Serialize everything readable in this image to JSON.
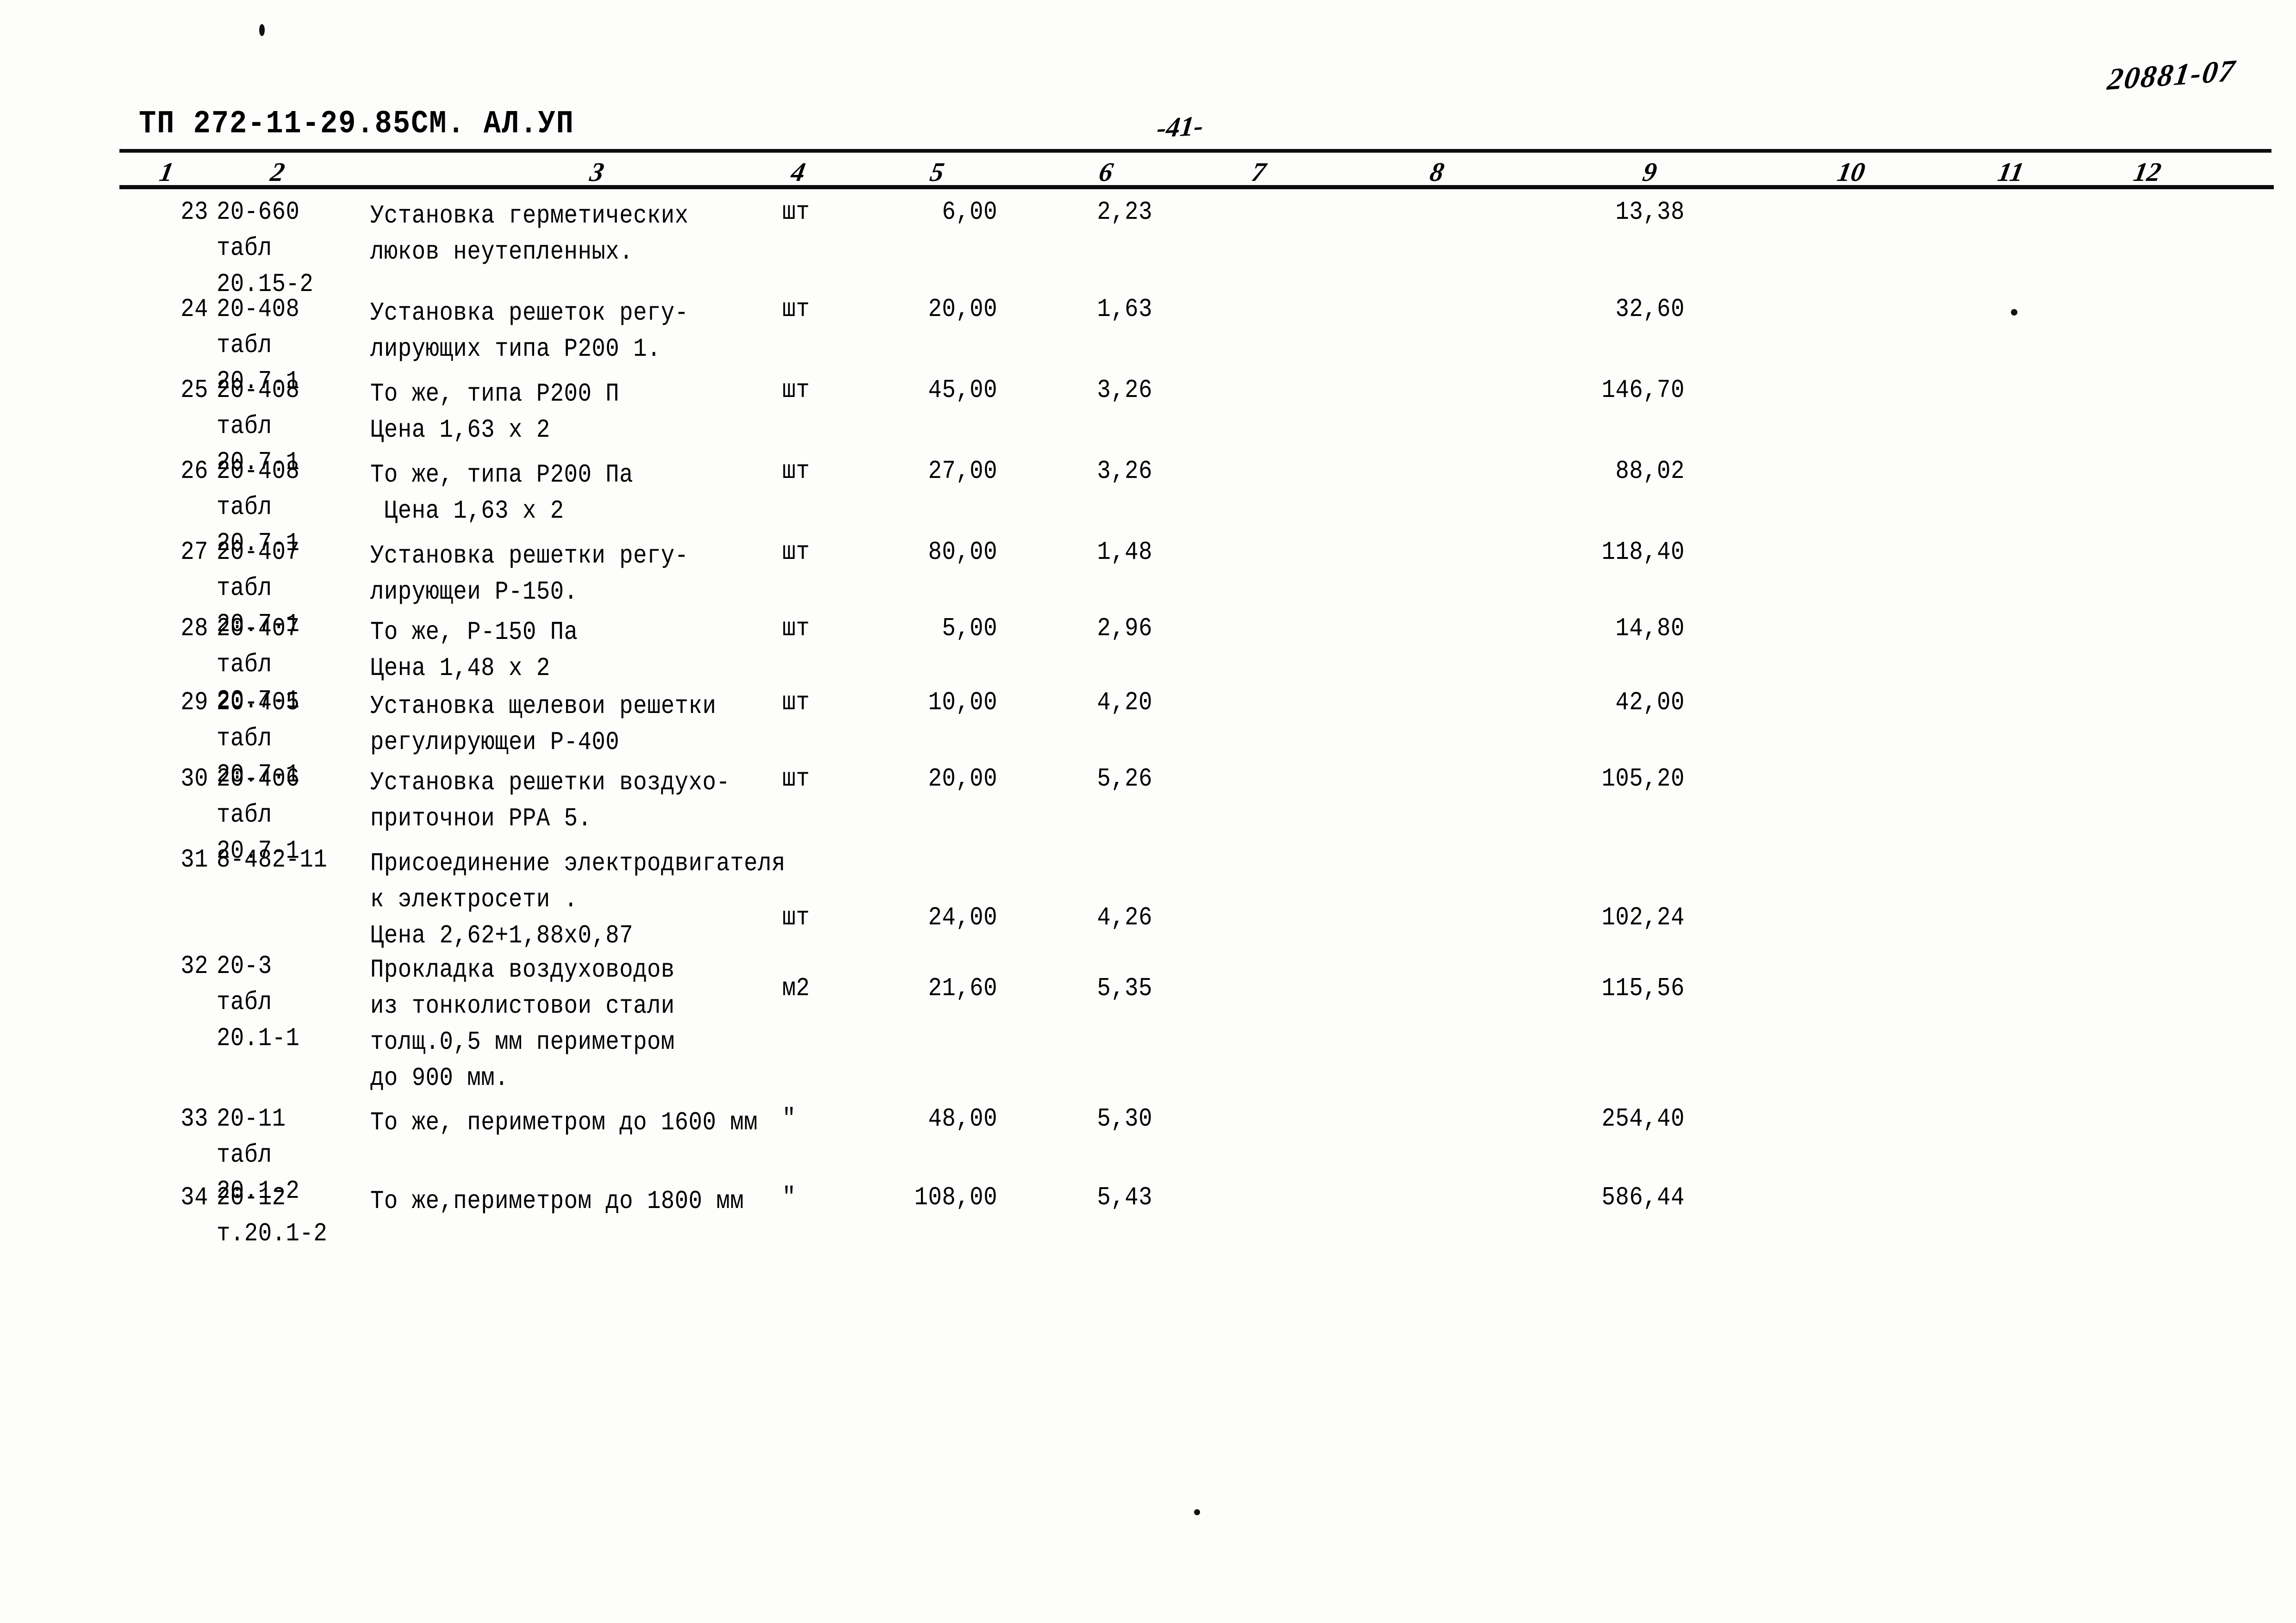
{
  "header": {
    "doc_code": "ТП 272-11-29.85СМ. АЛ.УП",
    "page_folio": "-41-",
    "stamp_number": "20881-07"
  },
  "table": {
    "column_numbers": [
      "1",
      "2",
      "3",
      "4",
      "5",
      "6",
      "7",
      "8",
      "9",
      "10",
      "11",
      "12"
    ],
    "rows": [
      {
        "num": "23",
        "code": [
          "20-660",
          "табл",
          "20.15-2"
        ],
        "desc": [
          "Установка герметических",
          "люков неутепленных."
        ],
        "unit": "шт",
        "qty": "6,00",
        "price": "2,23",
        "c7": "",
        "c8": "",
        "total": "13,38",
        "c10": "",
        "c11": "",
        "c12": ""
      },
      {
        "num": "24",
        "code": [
          "20-408",
          "табл",
          "20.7-1"
        ],
        "desc": [
          "Установка решеток регу-",
          "лирующих типа Р200 1."
        ],
        "unit": "шт",
        "qty": "20,00",
        "price": "1,63",
        "c7": "",
        "c8": "",
        "total": "32,60",
        "c10": "",
        "c11": "",
        "c12": ""
      },
      {
        "num": "25",
        "code": [
          "20-408",
          "табл",
          "20.7-1"
        ],
        "desc": [
          "То же, типа Р200 П",
          "Цена 1,63 х 2"
        ],
        "unit": "шт",
        "qty": "45,00",
        "price": "3,26",
        "c7": "",
        "c8": "",
        "total": "146,70",
        "c10": "",
        "c11": "",
        "c12": ""
      },
      {
        "num": "26",
        "code": [
          "20-408",
          "табл",
          "20.7-1"
        ],
        "desc": [
          "То же, типа Р200 Па",
          " Цена 1,63 х 2"
        ],
        "unit": "шт",
        "qty": "27,00",
        "price": "3,26",
        "c7": "",
        "c8": "",
        "total": "88,02",
        "c10": "",
        "c11": "",
        "c12": ""
      },
      {
        "num": "27",
        "code": [
          "20-407",
          "табл",
          "20.7-1"
        ],
        "desc": [
          "Установка решетки регу-",
          "лирующеи Р-150."
        ],
        "unit": "шт",
        "qty": "80,00",
        "price": "1,48",
        "c7": "",
        "c8": "",
        "total": "118,40",
        "c10": "",
        "c11": "",
        "c12": ""
      },
      {
        "num": "28",
        "code": [
          "20-407",
          "табл",
          "20.7-1"
        ],
        "desc": [
          "То же, Р-150 Па",
          "Цена 1,48 х 2"
        ],
        "unit": "шт",
        "qty": "5,00",
        "price": "2,96",
        "c7": "",
        "c8": "",
        "total": "14,80",
        "c10": "",
        "c11": "",
        "c12": ""
      },
      {
        "num": "29",
        "code": [
          "20-405",
          "табл",
          "20.7-1"
        ],
        "desc": [
          "Установка щелевои решетки",
          "регулирующеи Р-400"
        ],
        "unit": "шт",
        "qty": "10,00",
        "price": "4,20",
        "c7": "",
        "c8": "",
        "total": "42,00",
        "c10": "",
        "c11": "",
        "c12": ""
      },
      {
        "num": "30",
        "code": [
          "20-406",
          "табл",
          "20.7-1"
        ],
        "desc": [
          "Установка решетки воздухо-",
          "приточнои РРА 5."
        ],
        "unit": "шт",
        "qty": "20,00",
        "price": "5,26",
        "c7": "",
        "c8": "",
        "total": "105,20",
        "c10": "",
        "c11": "",
        "c12": ""
      },
      {
        "num": "31",
        "code": [
          "8-482-11"
        ],
        "desc": [
          "Присоединение электродвигателя",
          "к электросети .",
          "Цена 2,62+1,88х0,87"
        ],
        "unit": "шт",
        "qty": "24,00",
        "price": "4,26",
        "c7": "",
        "c8": "",
        "total": "102,24",
        "c10": "",
        "c11": "",
        "c12": ""
      },
      {
        "num": "32",
        "code": [
          "20-3",
          "табл",
          "20.1-1"
        ],
        "desc": [
          "Прокладка воздуховодов",
          "из тонколистовои стали",
          "толщ.0,5 мм периметром",
          "до 900 мм."
        ],
        "unit": "м2",
        "qty": "21,60",
        "price": "5,35",
        "c7": "",
        "c8": "",
        "total": "115,56",
        "c10": "",
        "c11": "",
        "c12": ""
      },
      {
        "num": "33",
        "code": [
          "20-11",
          "табл",
          "20.1-2"
        ],
        "desc": [
          "То же, периметром до 1600 мм"
        ],
        "unit": "\"",
        "qty": "48,00",
        "price": "5,30",
        "c7": "",
        "c8": "",
        "total": "254,40",
        "c10": "",
        "c11": "",
        "c12": ""
      },
      {
        "num": "34",
        "code": [
          "20-12",
          "т.20.1-2"
        ],
        "desc": [
          "То же,периметром до 1800 мм"
        ],
        "unit": "\"",
        "qty": "108,00",
        "price": "5,43",
        "c7": "",
        "c8": "",
        "total": "586,44",
        "c10": "",
        "c11": "",
        "c12": ""
      }
    ]
  }
}
